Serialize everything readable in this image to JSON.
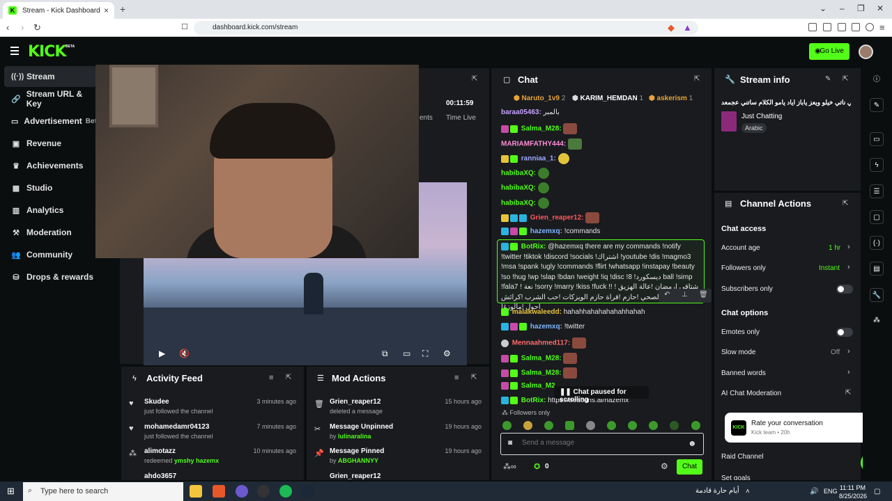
{
  "browser": {
    "tab_title": "Stream - Kick Dashboard",
    "url": "dashboard.kick.com/stream"
  },
  "header": {
    "logo": "KICK",
    "logo_badge": "BETA",
    "go_live": "Go Live"
  },
  "sidebar": {
    "items": [
      {
        "label": "Stream",
        "icon": "broadcast-icon"
      },
      {
        "label": "Stream URL & Key",
        "icon": "link-icon"
      },
      {
        "label": "Advertisement",
        "icon": "ad-icon",
        "badge": "Beta"
      },
      {
        "label": "Revenue",
        "icon": "wallet-icon"
      },
      {
        "label": "Achievements",
        "icon": "trophy-icon"
      },
      {
        "label": "Studio",
        "icon": "film-icon"
      },
      {
        "label": "Analytics",
        "icon": "chart-icon"
      },
      {
        "label": "Moderation",
        "icon": "hammer-icon"
      },
      {
        "label": "Community",
        "icon": "people-icon"
      },
      {
        "label": "Drops & rewards",
        "icon": "gift-icon"
      }
    ]
  },
  "stream_panel": {
    "time_value": "00:11:59",
    "time_label": "Time Live",
    "partial_label": "ents"
  },
  "activity_feed": {
    "title": "Activity Feed",
    "items": [
      {
        "name": "Skudee",
        "sub": "just followed the channel",
        "time": "3 minutes ago"
      },
      {
        "name": "mohamedamr04123",
        "sub": "just followed the channel",
        "time": "7 minutes ago"
      },
      {
        "name": "alimotazz",
        "sub": "redeemed",
        "sub_highlight": "ymshy hazemx",
        "time": "10 minutes ago"
      },
      {
        "name": "ahdo3657",
        "sub": "",
        "time": ""
      }
    ]
  },
  "mod_actions": {
    "title": "Mod Actions",
    "items": [
      {
        "name": "Grien_reaper12",
        "sub": "deleted a message",
        "time": "15 hours ago"
      },
      {
        "name": "Message Unpinned",
        "sub": "by",
        "sub_highlight": "lulinaralina",
        "time": "19 hours ago"
      },
      {
        "name": "Message Pinned",
        "sub": "by",
        "sub_highlight": "ABGHANNYY",
        "time": "19 hours ago"
      },
      {
        "name": "Grien_reaper12",
        "sub": "",
        "time": ""
      }
    ]
  },
  "chat": {
    "title": "Chat",
    "top_users": [
      {
        "name": "Naruto_1v9",
        "count": "2",
        "color": "#e8a33a"
      },
      {
        "name": "KARIM_HEMDAN",
        "count": "1",
        "color": "#ffffff"
      },
      {
        "name": "askerism",
        "count": "1",
        "color": "#e8a33a"
      }
    ],
    "messages": [
      {
        "user": "baraa05463:",
        "text": "بالمبر",
        "color": "#c9a0ff"
      },
      {
        "user": "Salma_M28:",
        "text": "",
        "color": "#53fc18"
      },
      {
        "user": "MARIAMFATHY444:",
        "text": "",
        "color": "#ff8fd6"
      },
      {
        "user": "ranniaa_1:",
        "text": "",
        "color": "#a0a8ff"
      },
      {
        "user": "habibaXQ:",
        "text": "",
        "color": "#53fc18"
      },
      {
        "user": "habibaXQ:",
        "text": "",
        "color": "#53fc18"
      },
      {
        "user": "habibaXQ:",
        "text": "",
        "color": "#53fc18"
      },
      {
        "user": "Grien_reaper12:",
        "text": "",
        "color": "#ff5a5a"
      },
      {
        "user": "hazemxq:",
        "text": "!commands",
        "color": "#7fb6ff"
      }
    ],
    "botrix": {
      "user": "BotRix:",
      "text": "@hazemxq there are my commands !notify !twitter !tiktok !discord !socials !اشتراك !youtube !dis !magmo3 !msa !spank !ugly !commands !flirt !whatsapp !instapay !beauty !so !hug !wp !slap !bdan !weight !iq !disc !8 !ديسكورد ball !simp !fala7 ! نعة !sorry !marry !kiss !fuck !! شتاقي ارمضان !عالة الهزيق ! الزوج الصحي !حازم !قراة حازم الويزكات !حب الشرب !كرائش !kob !احول !مالوزغا"
    },
    "messages_after": [
      {
        "user": "malakwaleedd:",
        "text": "hahahhahahahahahhahah",
        "color": "#e8c33a"
      },
      {
        "user": "hazemxq:",
        "text": "!twitter",
        "color": "#7fb6ff"
      },
      {
        "user": "Mennaahmed117:",
        "text": "",
        "color": "#ff6b6b"
      },
      {
        "user": "Salma_M28:",
        "text": "",
        "color": "#53fc18"
      },
      {
        "user": "Salma_M28:",
        "text": "",
        "color": "#53fc18"
      },
      {
        "user": "Salma_M2...",
        "text": "",
        "color": "#53fc18"
      },
      {
        "user": "BotRix:",
        "text": "https://beacons.ai/hazemx",
        "color": "#53fc18"
      }
    ],
    "paused": "Chat paused for scrolling",
    "followers_only": "Followers only",
    "input_placeholder": "Send a message",
    "viewer_count": "0",
    "send_button": "Chat"
  },
  "stream_info": {
    "title": "Stream info",
    "stream_title": "شالاتي ناتي خيلو ويعز ياباز اياد يامو الكلام ساتني عجمعد",
    "category": "Just Chatting",
    "language": "Arabic"
  },
  "channel_actions": {
    "title": "Channel Actions",
    "chat_access_heading": "Chat access",
    "account_age_label": "Account age",
    "account_age_value": "1 hr",
    "followers_only_label": "Followers only",
    "followers_only_value": "Instant",
    "subscribers_only_label": "Subscribers only",
    "chat_options_heading": "Chat options",
    "emotes_only_label": "Emotes only",
    "slow_mode_label": "Slow mode",
    "slow_mode_value": "Off",
    "banned_words_label": "Banned words",
    "ai_moderation_label": "AI Chat Moderation",
    "raid_label": "Raid Channel",
    "partial_label": "Set goals"
  },
  "toast": {
    "logo": "KICK",
    "title": "Rate your conversation",
    "sub": "Kick team • 20h"
  },
  "fab_badge": "1",
  "taskbar": {
    "search_placeholder": "Type here to search",
    "weather_text": "أيام حارة قادمة",
    "language": "ENG",
    "time": "11:11 PM",
    "date": "8/25/2026"
  },
  "colors": {
    "accent": "#53fc18",
    "background": "#0b0e0f",
    "panel": "#191b1f"
  }
}
